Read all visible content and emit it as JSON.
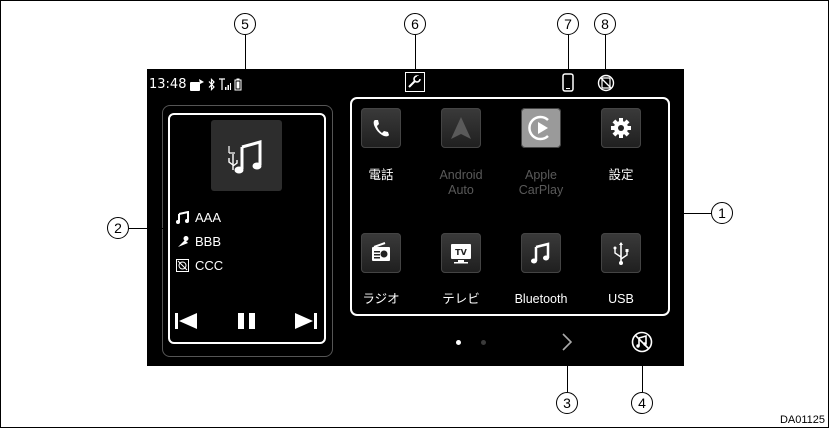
{
  "status_bar": {
    "time": "13:48",
    "icons": [
      "phone-in-car-icon",
      "bluetooth-icon",
      "signal-icon",
      "battery-icon"
    ]
  },
  "header_icons": [
    "wrench-icon",
    "phone-icon",
    "no-sync-icon"
  ],
  "media": {
    "sources": [
      {
        "icon": "music-note-icon",
        "label": "AAA"
      },
      {
        "icon": "artist-icon",
        "label": "BBB"
      },
      {
        "icon": "album-icon",
        "label": "CCC"
      }
    ],
    "controls": [
      "previous-track-icon",
      "pause-icon",
      "next-track-icon"
    ]
  },
  "apps": [
    {
      "id": "phone",
      "label_lines": [
        "電話"
      ],
      "dim": false,
      "icon": "phone-handset-icon"
    },
    {
      "id": "android-auto",
      "label_lines": [
        "Android",
        "Auto"
      ],
      "dim": true,
      "icon": "android-auto-icon"
    },
    {
      "id": "apple-carplay",
      "label_lines": [
        "Apple",
        "CarPlay"
      ],
      "dim": true,
      "icon": "carplay-icon"
    },
    {
      "id": "settings",
      "label_lines": [
        "設定"
      ],
      "dim": false,
      "icon": "gear-icon"
    },
    {
      "id": "radio",
      "label_lines": [
        "ラジオ"
      ],
      "dim": false,
      "icon": "radio-icon"
    },
    {
      "id": "tv",
      "label_lines": [
        "テレビ"
      ],
      "dim": false,
      "icon": "tv-icon"
    },
    {
      "id": "bluetooth",
      "label_lines": [
        "Bluetooth"
      ],
      "dim": false,
      "icon": "music-note-icon"
    },
    {
      "id": "usb",
      "label_lines": [
        "USB"
      ],
      "dim": false,
      "icon": "usb-icon"
    }
  ],
  "page_indicator": {
    "current": 1,
    "total": 2
  },
  "callouts": [
    "1",
    "2",
    "3",
    "4",
    "5",
    "6",
    "7",
    "8"
  ],
  "diagram_id": "DA01125"
}
